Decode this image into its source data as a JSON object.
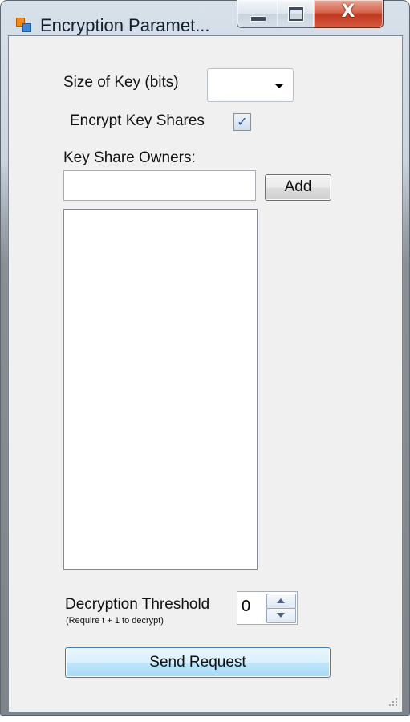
{
  "window": {
    "title": "Encryption Paramet...",
    "close_glyph": "X"
  },
  "form": {
    "key_size_label": "Size of Key (bits)",
    "key_size_value": "",
    "encrypt_label": "Encrypt Key Shares",
    "encrypt_checked": true,
    "encrypt_check_glyph": "✓",
    "owners_label": "Key Share Owners:",
    "owner_input_value": "",
    "add_button": "Add",
    "owners_list": [],
    "threshold_label": "Decryption Threshold",
    "threshold_value": "0",
    "threshold_note": "(Require t + 1 to decrypt)",
    "send_button": "Send Request"
  },
  "colors": {
    "client_bg": "#f0f0f0",
    "close_button": "#c0391f",
    "default_button_border": "#3c7fb1"
  },
  "icons": [
    "app-icon",
    "minimize-icon",
    "maximize-icon",
    "close-icon",
    "dropdown-arrow-icon",
    "checkmark-icon",
    "spin-up-icon",
    "spin-down-icon",
    "resize-grip-icon"
  ]
}
